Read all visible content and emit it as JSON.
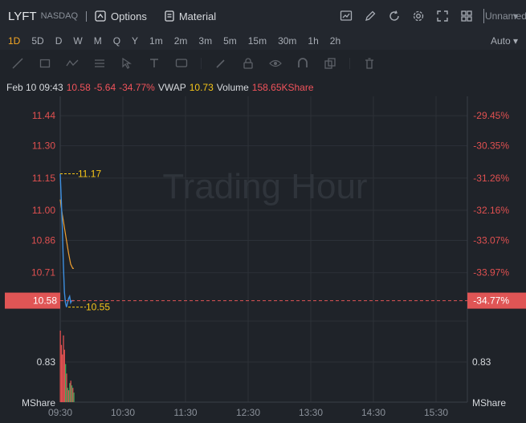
{
  "header": {
    "symbol": "LYFT",
    "exchange": "NASDAQ",
    "options_label": "Options",
    "material_label": "Material",
    "account_label": "Unnamed"
  },
  "intervals": [
    "1D",
    "5D",
    "D",
    "W",
    "M",
    "Q",
    "Y",
    "1m",
    "2m",
    "3m",
    "5m",
    "15m",
    "30m",
    "1h",
    "2h"
  ],
  "active_interval": "1D",
  "auto_label": "Auto",
  "info": {
    "date": "Feb 10 09:43",
    "price": "10.58",
    "change": "-5.64",
    "change_pct": "-34.77%",
    "vwap_label": "VWAP",
    "vwap": "10.73",
    "volume_label": "Volume",
    "volume": "158.65KShare"
  },
  "chart_data": {
    "type": "line",
    "watermark": "Trading Hour",
    "y_ticks": [
      "11.44",
      "11.30",
      "11.15",
      "11.00",
      "10.86",
      "10.71"
    ],
    "y_tick_values": [
      11.44,
      11.3,
      11.15,
      11.0,
      10.86,
      10.71
    ],
    "pct_ticks": [
      "-29.45%",
      "-30.35%",
      "-31.26%",
      "-32.16%",
      "-33.07%",
      "-33.97%"
    ],
    "ylim": [
      10.5,
      11.53
    ],
    "x_ticks": [
      "09:30",
      "10:30",
      "11:30",
      "12:30",
      "13:30",
      "14:30",
      "15:30"
    ],
    "x_minutes": [
      0,
      60,
      120,
      180,
      240,
      300,
      360
    ],
    "current_price": "10.58",
    "current_pct": "-34.77%",
    "current_value": 10.58,
    "high_label": "11.17",
    "high_value": 11.17,
    "low_label": "10.55",
    "low_value": 10.55,
    "price_series": {
      "minutes": [
        0,
        1,
        2,
        3,
        4,
        5,
        6,
        7,
        8,
        9,
        10,
        11,
        12,
        13
      ],
      "values": [
        11.17,
        11.05,
        10.92,
        10.75,
        10.62,
        10.57,
        10.55,
        10.57,
        10.59,
        10.6,
        10.57,
        10.58,
        10.58,
        10.58
      ]
    },
    "vwap_series": {
      "minutes": [
        0,
        2,
        4,
        6,
        8,
        10,
        12,
        13
      ],
      "values": [
        11.05,
        10.98,
        10.92,
        10.86,
        10.8,
        10.75,
        10.73,
        10.73
      ]
    },
    "volume_ticks": [
      "0.83"
    ],
    "volume_ylim": [
      0,
      1.6
    ],
    "volume_unit_left": "MShare",
    "volume_unit_right": "MShare",
    "volume_bars": {
      "minutes": [
        0,
        1,
        2,
        3,
        4,
        5,
        6,
        7,
        8,
        9,
        10,
        11,
        12,
        13
      ],
      "values": [
        1.5,
        1.2,
        1.0,
        1.4,
        1.1,
        0.8,
        0.6,
        0.3,
        0.25,
        0.4,
        0.45,
        0.35,
        0.3,
        0.2
      ],
      "up": [
        false,
        false,
        false,
        false,
        false,
        true,
        false,
        true,
        false,
        true,
        false,
        true,
        false,
        true
      ]
    },
    "colors": {
      "price": "#3d8fe0",
      "vwap": "#f0a030",
      "down": "#e05050",
      "up": "#3aaa5a",
      "current": "#e05555",
      "marker": "#f5c518"
    }
  }
}
